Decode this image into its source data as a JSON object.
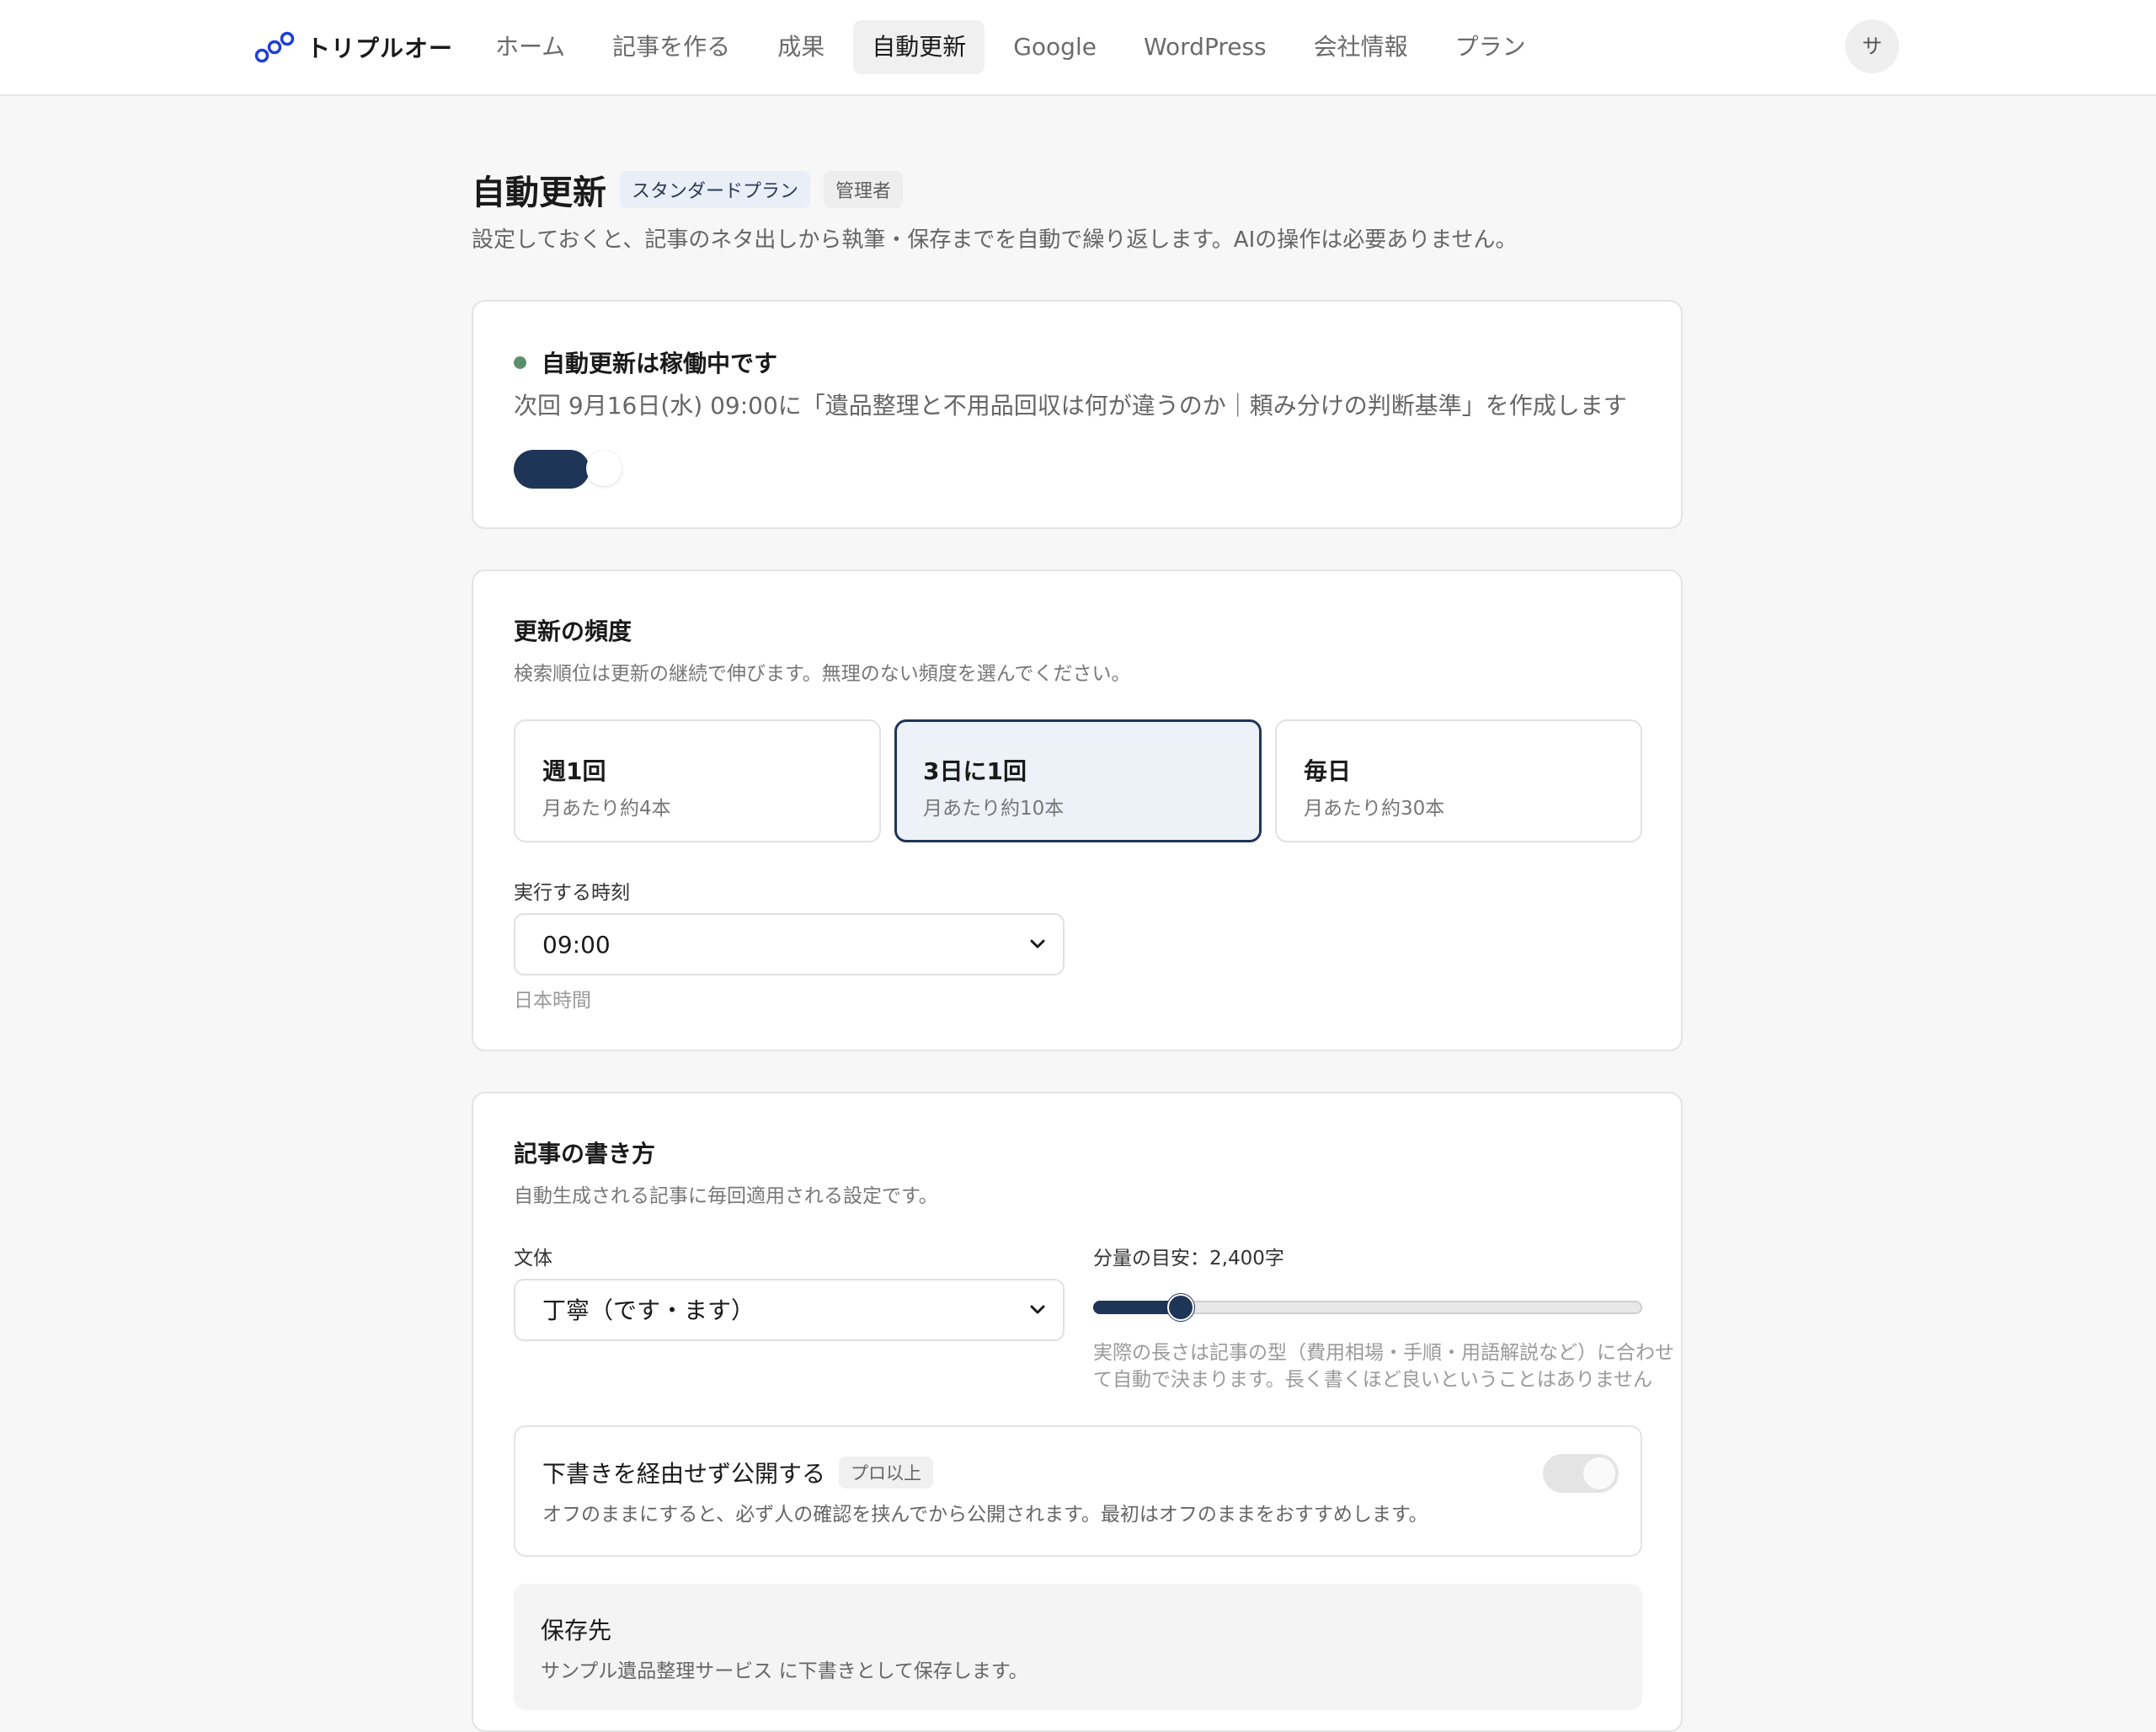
{
  "app": {
    "brand": "トリプルオー",
    "avatar_initial": "サ"
  },
  "nav": {
    "items": [
      {
        "label": "ホーム",
        "active": false
      },
      {
        "label": "記事を作る",
        "active": false
      },
      {
        "label": "成果",
        "active": false
      },
      {
        "label": "自動更新",
        "active": true
      },
      {
        "label": "Google",
        "active": false
      },
      {
        "label": "WordPress",
        "active": false
      },
      {
        "label": "会社情報",
        "active": false
      },
      {
        "label": "プラン",
        "active": false
      }
    ]
  },
  "header": {
    "title": "自動更新",
    "plan_badge": "スタンダードプラン",
    "role_badge": "管理者",
    "description": "設定しておくと、記事のネタ出しから執筆・保存までを自動で繰り返します。AIの操作は必要ありません。"
  },
  "status": {
    "label": "自動更新は稼働中です",
    "next_run": "次回 9月16日(水) 09:00に「遺品整理と不用品回収は何が違うのか｜頼み分けの判断基準」を作成します",
    "enabled": true
  },
  "frequency": {
    "title": "更新の頻度",
    "description": "検索順位は更新の継続で伸びます。無理のない頻度を選んでください。",
    "options": [
      {
        "label": "週1回",
        "sub": "月あたり約4本",
        "selected": false
      },
      {
        "label": "3日に1回",
        "sub": "月あたり約10本",
        "selected": true
      },
      {
        "label": "毎日",
        "sub": "月あたり約30本",
        "selected": false
      }
    ],
    "time_label": "実行する時刻",
    "time_value": "09:00",
    "time_hint": "日本時間"
  },
  "writing": {
    "title": "記事の書き方",
    "description": "自動生成される記事に毎回適用される設定です。",
    "style_label": "文体",
    "style_value": "丁寧（です・ます）",
    "length_label": "分量の目安：2,400字",
    "length_min": 0,
    "length_max": 15000,
    "length_value": 2400,
    "length_hint_1": "実際の長さは記事の型（費用相場・手順・用語解説など）に合わせ",
    "length_hint_2": "て自動で決まります。長く書くほど良いということはありません",
    "publish_label": "下書きを経由せず公開する",
    "publish_badge": "プロ以上",
    "publish_desc": "オフのままにすると、必ず人の確認を挟んでから公開されます。最初はオフのままをおすすめします。",
    "publish_enabled": false,
    "dest_title": "保存先",
    "dest_desc": "サンプル遺品整理サービス に下書きとして保存します。"
  },
  "colors": {
    "accent": "#1f3558",
    "status_ok": "#5b8f6b",
    "brand_logo": "#1f3fd6"
  }
}
